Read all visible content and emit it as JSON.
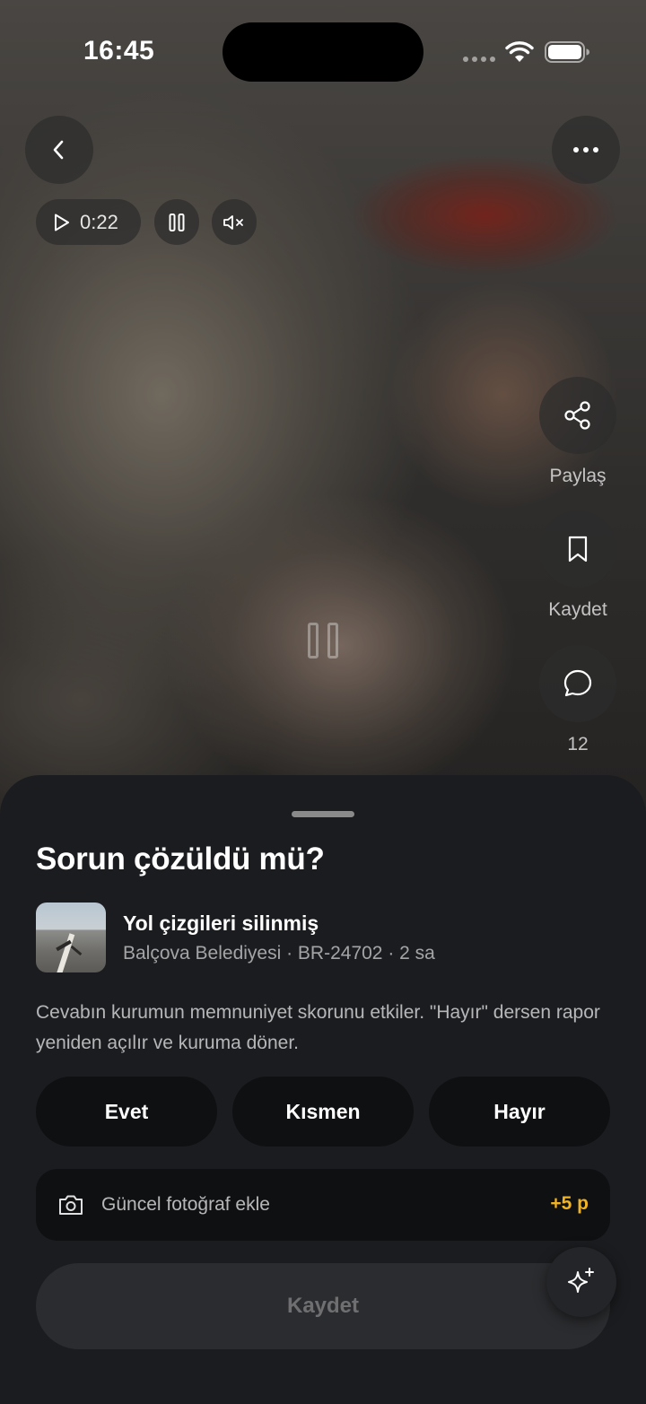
{
  "status_bar": {
    "time": "16:45"
  },
  "video": {
    "elapsed": "0:22",
    "icons": {
      "back": "chevron-left-icon",
      "more": "ellipsis-icon",
      "play": "play-icon",
      "pause": "pause-icon",
      "mute": "speaker-muted-icon"
    }
  },
  "side_actions": {
    "share_label": "Paylaş",
    "save_label": "Kaydet",
    "comment_count": "12"
  },
  "sheet": {
    "title": "Sorun çözüldü mü?",
    "issue": {
      "title": "Yol çizgileri silinmiş",
      "meta": "Balçova Belediyesi · BR-24702 · 2 sa"
    },
    "description": "Cevabın kurumun memnuniyet skorunu etkiler. \"Hayır\" dersen rapor yeniden açılır ve kuruma döner.",
    "choices": {
      "yes": "Evet",
      "partial": "Kısmen",
      "no": "Hayır"
    },
    "photo": {
      "label": "Güncel fotoğraf ekle",
      "points": "+5 p"
    },
    "submit_label": "Kaydet"
  },
  "colors": {
    "accent_points": "#f0b323",
    "sheet_bg": "#1b1c1f",
    "button_bg": "#0f1012"
  }
}
